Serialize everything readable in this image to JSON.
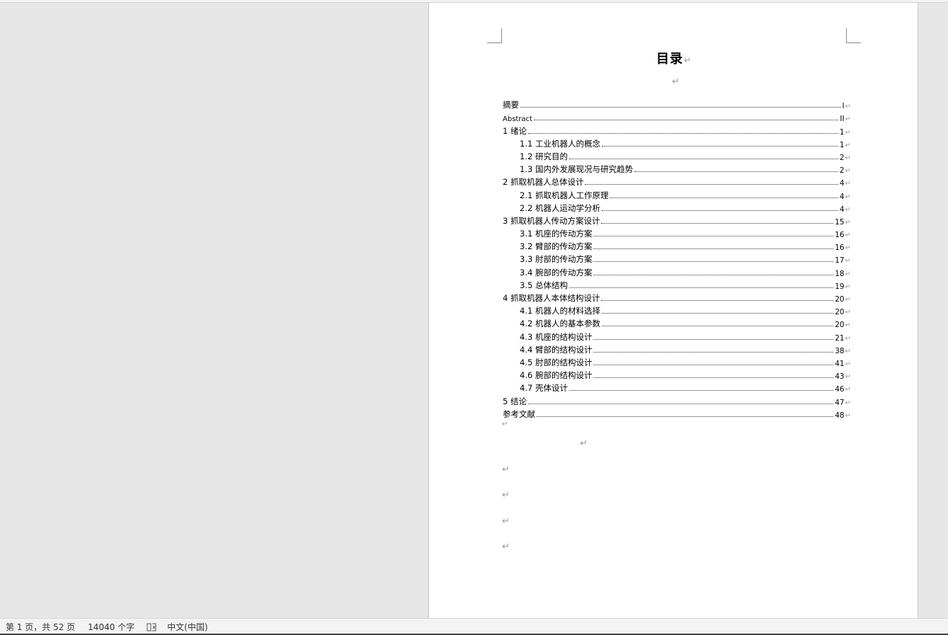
{
  "document": {
    "title": "目录",
    "paragraph_mark": "↵",
    "toc": [
      {
        "label": "摘要",
        "page": "I",
        "level": 1
      },
      {
        "label": "Abstract",
        "page": "II",
        "level": 1
      },
      {
        "label": "1 绪论",
        "page": "1",
        "level": 1
      },
      {
        "label": "1.1 工业机器人的概念",
        "page": "1",
        "level": 2
      },
      {
        "label": "1.2 研究目的",
        "page": "2",
        "level": 2
      },
      {
        "label": "1.3 国内外发展现况与研究趋势",
        "page": "2",
        "level": 2
      },
      {
        "label": "2 抓取机器人总体设计",
        "page": "4",
        "level": 1
      },
      {
        "label": "2.1 抓取机器人工作原理",
        "page": "4",
        "level": 2
      },
      {
        "label": "2.2 机器人运动学分析",
        "page": "4",
        "level": 2
      },
      {
        "label": "3 抓取机器人传动方案设计",
        "page": "15",
        "level": 1
      },
      {
        "label": "3.1 机座的传动方案",
        "page": "16",
        "level": 2
      },
      {
        "label": "3.2 臂部的传动方案",
        "page": "16",
        "level": 2
      },
      {
        "label": "3.3 肘部的传动方案",
        "page": "17",
        "level": 2
      },
      {
        "label": "3.4 腕部的传动方案",
        "page": "18",
        "level": 2
      },
      {
        "label": "3.5 总体结构",
        "page": "19",
        "level": 2
      },
      {
        "label": "4 抓取机器人本体结构设计",
        "page": "20",
        "level": 1
      },
      {
        "label": "4.1 机器人的材料选择",
        "page": "20",
        "level": 2
      },
      {
        "label": "4.2 机器人的基本参数",
        "page": "20",
        "level": 2
      },
      {
        "label": "4.3 机座的结构设计",
        "page": "21",
        "level": 2
      },
      {
        "label": "4.4 臂部的结构设计",
        "page": "38",
        "level": 2
      },
      {
        "label": "4.5 肘部的结构设计",
        "page": "41",
        "level": 2
      },
      {
        "label": "4.6 腕部的结构设计",
        "page": "43",
        "level": 2
      },
      {
        "label": "4.7 壳体设计",
        "page": "46",
        "level": 2
      },
      {
        "label": "5 结论",
        "page": "47",
        "level": 1
      },
      {
        "label": "参考文献",
        "page": "48",
        "level": 1
      }
    ]
  },
  "status_bar": {
    "page_info": "第 1 页，共 52 页",
    "word_count": "14040 个字",
    "proofing_icon": "proofing-book-icon",
    "language": "中文(中国)"
  },
  "colors": {
    "workspace": "#e6e6e6",
    "page": "#ffffff",
    "status_bar": "#f3f3f3",
    "formatting_marks": "#9a9a9a"
  }
}
